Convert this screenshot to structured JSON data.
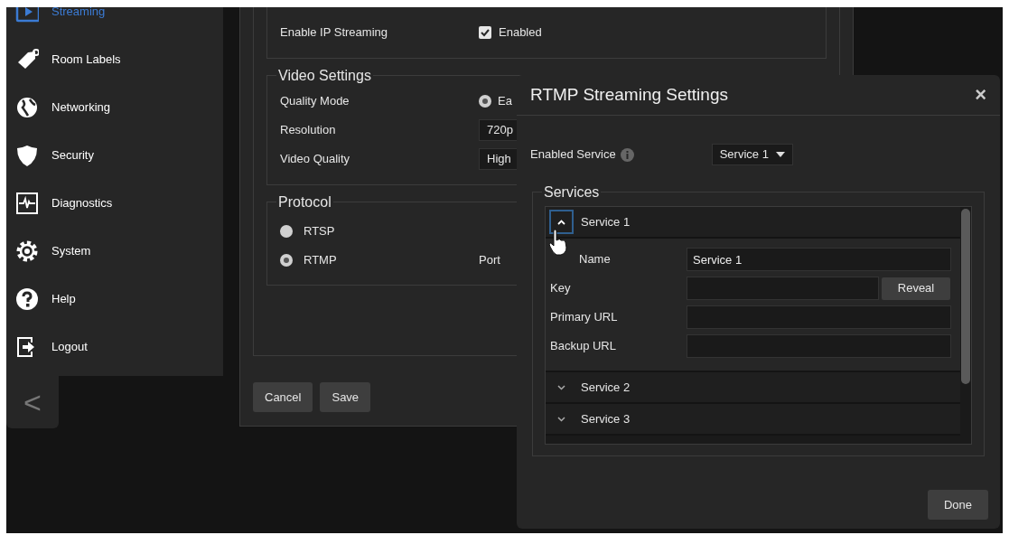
{
  "sidebar": {
    "items": [
      {
        "label": "Streaming",
        "selected": true
      },
      {
        "label": "Room Labels",
        "selected": false
      },
      {
        "label": "Networking",
        "selected": false
      },
      {
        "label": "Security",
        "selected": false
      },
      {
        "label": "Diagnostics",
        "selected": false
      },
      {
        "label": "System",
        "selected": false
      },
      {
        "label": "Help",
        "selected": false
      },
      {
        "label": "Logout",
        "selected": false
      }
    ],
    "collapse": "<"
  },
  "main": {
    "ip_streaming": {
      "label": "Enable IP Streaming",
      "checkbox_label": "Enabled",
      "checked": true
    },
    "video_settings": {
      "legend": "Video Settings",
      "rows": [
        {
          "label": "Quality Mode",
          "kind": "radio",
          "value": "Ea",
          "selected": true
        },
        {
          "label": "Resolution",
          "kind": "select",
          "value": "720p"
        },
        {
          "label": "Video Quality",
          "kind": "select",
          "value": "High"
        }
      ]
    },
    "protocol": {
      "legend": "Protocol",
      "options": [
        {
          "label": "RTSP",
          "selected": false
        },
        {
          "label": "RTMP",
          "selected": true
        }
      ],
      "port_label": "Port"
    },
    "buttons": [
      "Cancel",
      "Save"
    ]
  },
  "dialog": {
    "title": "RTMP Streaming Settings",
    "close": "×",
    "enabled_service": {
      "label": "Enabled Service",
      "value": "Service 1"
    },
    "services": {
      "legend": "Services",
      "items": [
        {
          "name": "Service 1",
          "expanded": true,
          "fields": [
            {
              "label": "Name",
              "value": "Service 1"
            },
            {
              "label": "Key",
              "button": "Reveal"
            },
            {
              "label": "Primary URL"
            },
            {
              "label": "Backup URL"
            }
          ]
        },
        {
          "name": "Service 2",
          "expanded": false
        },
        {
          "name": "Service 3",
          "expanded": false
        }
      ]
    },
    "done": "Done"
  }
}
